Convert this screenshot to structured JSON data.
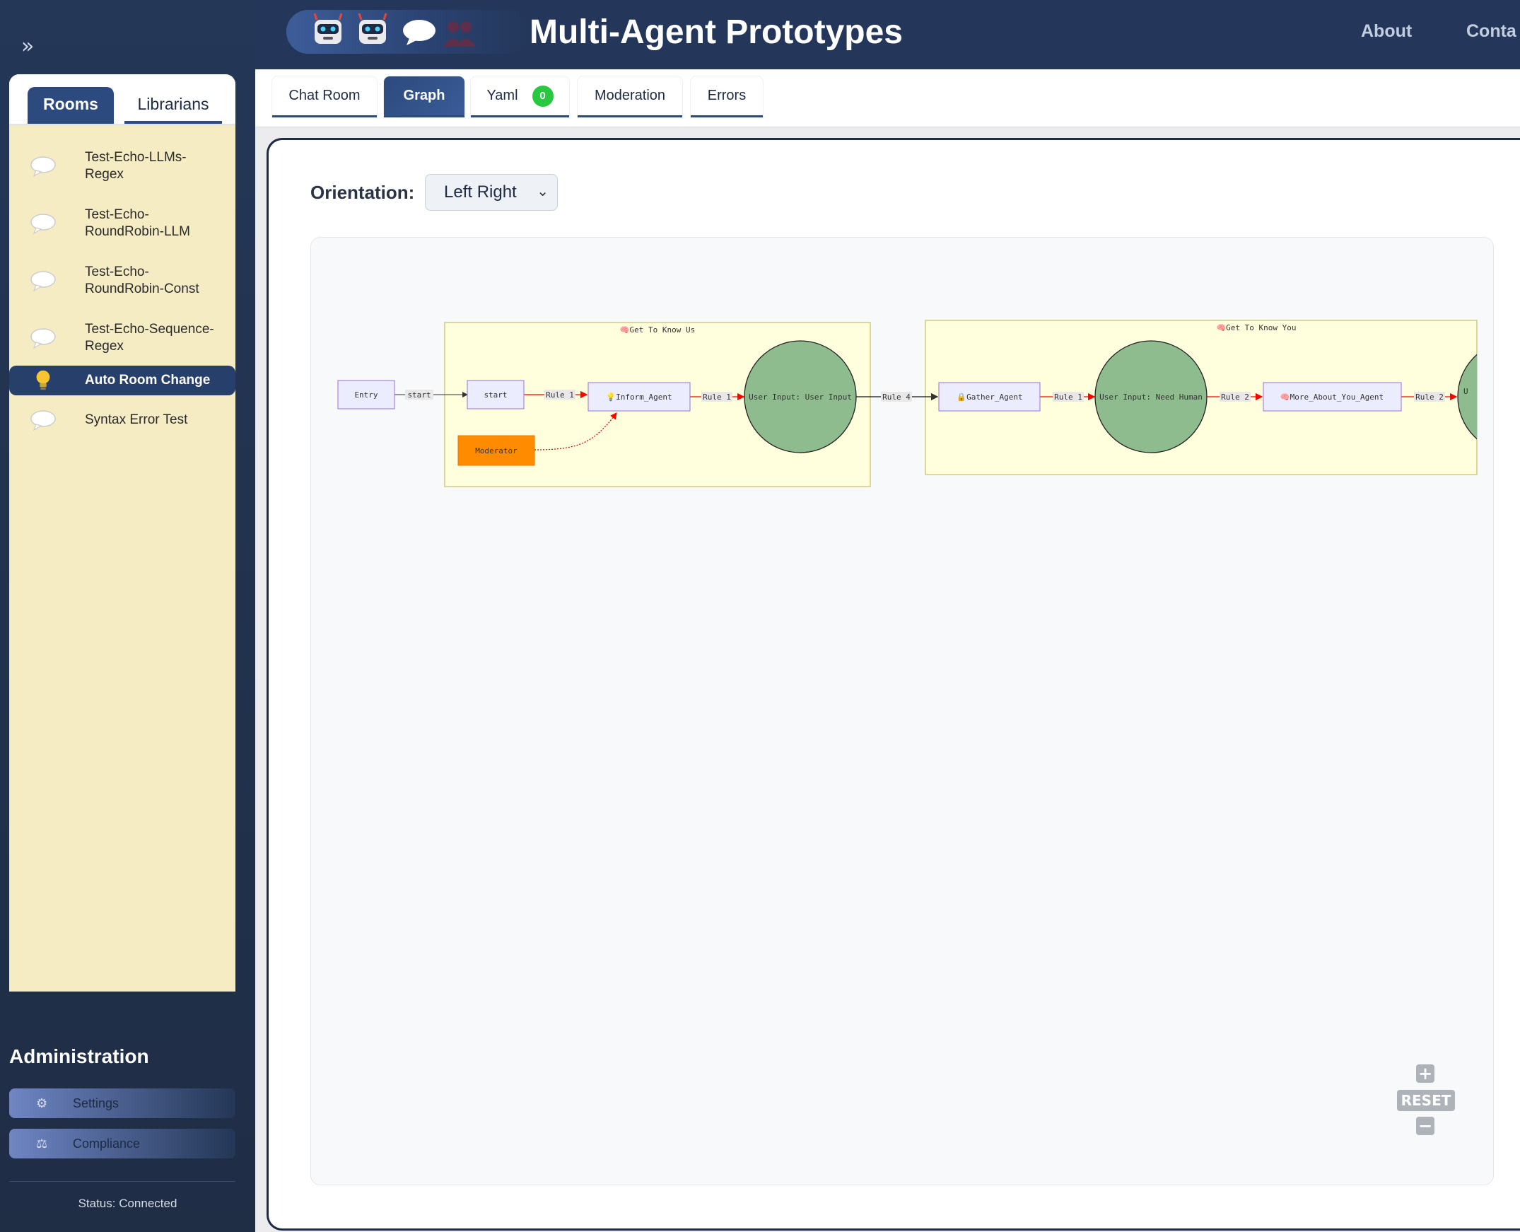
{
  "header": {
    "title": "Multi-Agent Prototypes",
    "nav": [
      "About",
      "Conta"
    ]
  },
  "sidebar": {
    "toggle": "»",
    "tabs": [
      "Rooms",
      "Librarians"
    ],
    "rooms": [
      {
        "label": "Test-Echo-LLMs-Regex",
        "line1": "Test-Echo-LLMs-",
        "line2": "Regex",
        "icon": "speech-bubble-icon"
      },
      {
        "label": "Test-Echo-RoundRobin-LLM",
        "line1": "Test-Echo-",
        "line2": "RoundRobin-LLM",
        "icon": "speech-bubble-icon"
      },
      {
        "label": "Test-Echo-RoundRobin-Const",
        "line1": "Test-Echo-",
        "line2": "RoundRobin-Const",
        "icon": "speech-bubble-icon"
      },
      {
        "label": "Test-Echo-Sequence-Regex",
        "line1": "Test-Echo-Sequence-",
        "line2": "Regex",
        "icon": "speech-bubble-icon"
      },
      {
        "label": "Auto Room Change",
        "line1": "Auto Room Change",
        "line2": "",
        "icon": "light-bulb-icon"
      },
      {
        "label": "Syntax Error Test",
        "line1": "Syntax Error Test",
        "line2": "",
        "icon": "speech-bubble-icon"
      }
    ],
    "admin_title": "Administration",
    "admin_items": [
      {
        "label": "Settings",
        "icon": "gear-icon"
      },
      {
        "label": "Compliance",
        "icon": "scales-icon"
      }
    ],
    "status": "Status: Connected"
  },
  "tabs": {
    "items": [
      "Chat Room",
      "Graph",
      "Yaml",
      "Moderation",
      "Errors"
    ],
    "active": "Graph",
    "yaml_badge": "0"
  },
  "graph": {
    "orientation_label": "Orientation:",
    "orientation_value": "Left Right",
    "groups": [
      {
        "title": "🧠Get To Know Us"
      },
      {
        "title": "🧠Get To Know You"
      }
    ],
    "nodes": {
      "entry": "Entry",
      "start": "start",
      "inform_agent": "💡Inform_Agent",
      "moderator": "Moderator",
      "user_input_1": "User Input: User Input",
      "gather_agent": "🔒Gather_Agent",
      "user_input_2": "User Input: Need Human",
      "more_about_you": "🧠More_About_You_Agent",
      "cut_node": "U"
    },
    "edges": {
      "start": "start",
      "rule1a": "Rule 1",
      "rule1b": "Rule 1",
      "rule4": "Rule 4",
      "rule1c": "Rule 1",
      "rule2a": "Rule 2",
      "rule2b": "Rule 2"
    },
    "zoom": {
      "plus": "+",
      "reset": "RESET",
      "minus": "−"
    }
  },
  "colors": {
    "header": "#24375a",
    "panel": "#f5ecc4",
    "group_fill": "#ffffde",
    "group_stroke": "#c8c270",
    "node_fill": "#ececff",
    "node_stroke": "#9370db",
    "circle_fill": "#8fbc8f",
    "moderator": "#ff8c00",
    "rule_edge": "#ff0000",
    "badge": "#28c840"
  }
}
